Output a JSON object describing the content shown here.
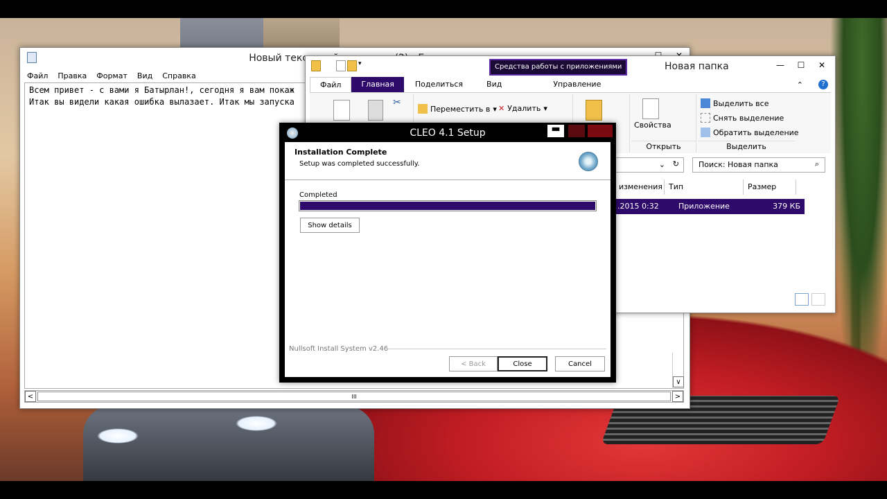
{
  "notepad": {
    "title": "Новый текстовый документ (2) - Блокнот",
    "menu": [
      "Файл",
      "Правка",
      "Формат",
      "Вид",
      "Справка"
    ],
    "lines": [
      "Всем привет - с вами я Батырлан!, сегодня я вам покаж",
      "Итак вы видели какая ошибка вылазает. Итак мы запуска"
    ]
  },
  "explorer": {
    "tools_badge": "Средства работы с приложениями",
    "title": "Новая папка",
    "tabs": [
      "Файл",
      "Главная",
      "Поделиться",
      "Вид",
      "Управление"
    ],
    "ribbon": {
      "move_to": "Переместить в",
      "delete": "Удалить",
      "properties": "Свойства",
      "open_group": "Открыть",
      "select_all": "Выделить все",
      "deselect": "Снять выделение",
      "invert": "Обратить выделение",
      "select_group": "Выделить"
    },
    "search_placeholder": "Поиск: Новая папка",
    "columns": [
      "изменения",
      "Тип",
      "Размер"
    ],
    "file": {
      "date": ".2015 0:32",
      "type": "Приложение",
      "size": "379 КБ"
    }
  },
  "setup": {
    "title": "CLEO 4.1 Setup",
    "heading": "Installation Complete",
    "subheading": "Setup was completed successfully.",
    "status_label": "Completed",
    "progress": 1.0,
    "show_details": "Show details",
    "branding": "Nullsoft Install System v2.46",
    "back": "< Back",
    "close": "Close",
    "cancel": "Cancel"
  },
  "colors": {
    "accent": "#2e0a6b",
    "dialog_frame": "#000000"
  }
}
